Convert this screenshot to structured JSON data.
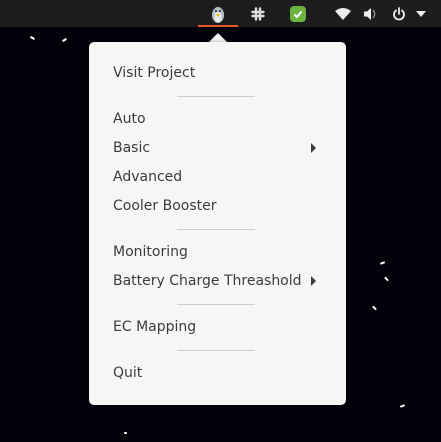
{
  "topbar": {
    "icons": [
      "tux-indicator-icon",
      "slack-icon",
      "shield-check-icon",
      "wifi-icon",
      "volume-icon",
      "power-icon",
      "chevron-down-icon"
    ],
    "accent": "#e95420"
  },
  "menu": {
    "items": [
      {
        "label": "Visit Project"
      },
      {
        "label": "Auto"
      },
      {
        "label": "Basic",
        "submenu": true
      },
      {
        "label": "Advanced"
      },
      {
        "label": "Cooler Booster"
      },
      {
        "label": "Monitoring"
      },
      {
        "label": "Battery Charge Threashold",
        "submenu": true
      },
      {
        "label": "EC Mapping"
      },
      {
        "label": "Quit"
      }
    ]
  }
}
